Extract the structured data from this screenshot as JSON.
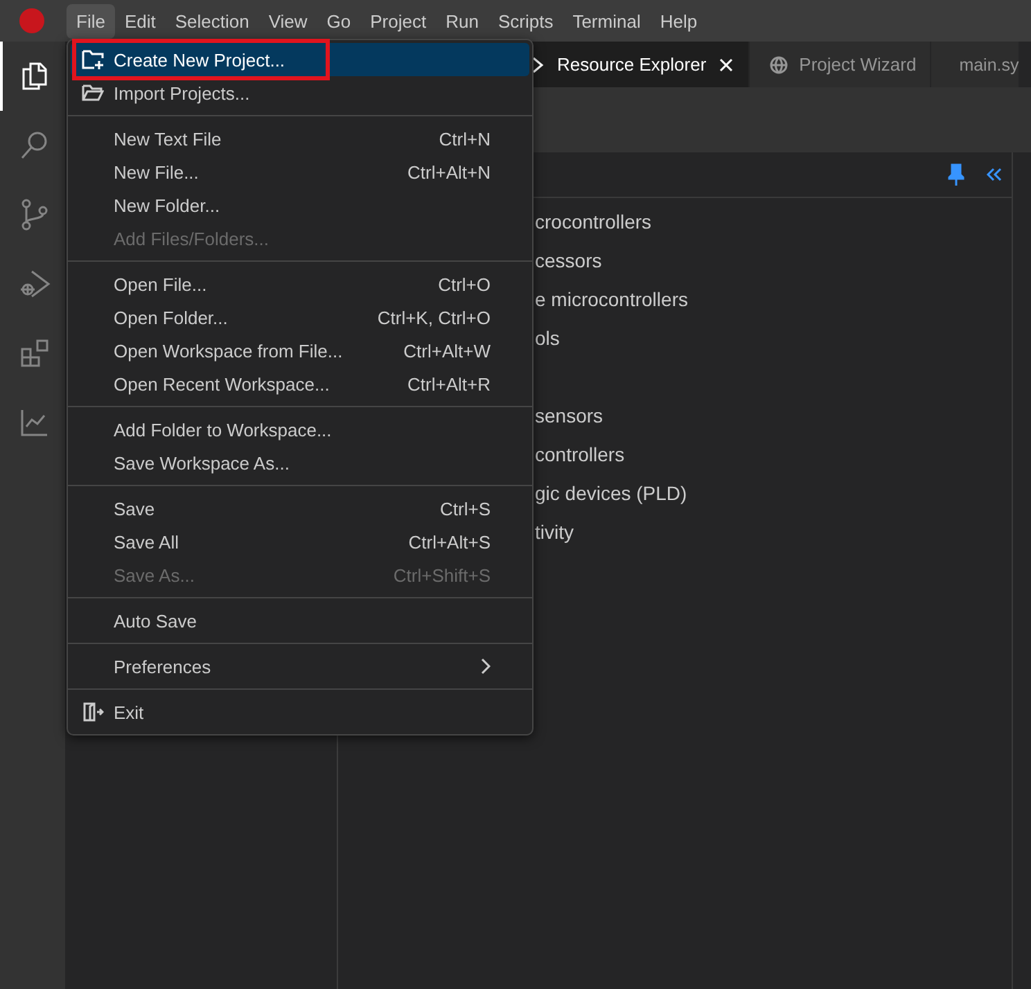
{
  "menubar": [
    {
      "label": "File",
      "selected": true
    },
    {
      "label": "Edit",
      "selected": false
    },
    {
      "label": "Selection",
      "selected": false
    },
    {
      "label": "View",
      "selected": false
    },
    {
      "label": "Go",
      "selected": false
    },
    {
      "label": "Project",
      "selected": false
    },
    {
      "label": "Run",
      "selected": false
    },
    {
      "label": "Scripts",
      "selected": false
    },
    {
      "label": "Terminal",
      "selected": false
    },
    {
      "label": "Help",
      "selected": false
    }
  ],
  "activity_bar": [
    {
      "kind": "files",
      "selected": true
    },
    {
      "kind": "search",
      "selected": false
    },
    {
      "kind": "source-control",
      "selected": false
    },
    {
      "kind": "debug",
      "selected": false
    },
    {
      "kind": "extensions",
      "selected": false
    },
    {
      "kind": "chart",
      "selected": false
    }
  ],
  "tabs": [
    {
      "label": "Resource Explorer",
      "kind": "explorer",
      "selected": true,
      "closable": true
    },
    {
      "label": "Project Wizard",
      "kind": "web",
      "selected": false,
      "closable": false
    },
    {
      "label": "main.sy",
      "kind": "file",
      "selected": false
    }
  ],
  "tree_items": [
    {
      "label": "crocontrollers"
    },
    {
      "label": "cessors"
    },
    {
      "label": "e microcontrollers"
    },
    {
      "label": "ols"
    },
    {
      "label": "sensors",
      "gap_before": true
    },
    {
      "label": "controllers"
    },
    {
      "label": "gic devices (PLD)"
    },
    {
      "label": "tivity"
    }
  ],
  "file_menu": {
    "groups": [
      [
        {
          "label": "Create New Project...",
          "kind": "new-project",
          "selected": true,
          "outlined": true,
          "disabled": false
        },
        {
          "label": "Import Projects...",
          "kind": "import",
          "selected": false,
          "outlined": false,
          "disabled": false
        }
      ],
      [
        {
          "label": "New Text File",
          "shortcut": "Ctrl+N",
          "kind": "plain",
          "selected": false,
          "outlined": false,
          "disabled": false
        },
        {
          "label": "New File...",
          "shortcut": "Ctrl+Alt+N",
          "kind": "plain",
          "selected": false,
          "outlined": false,
          "disabled": false
        },
        {
          "label": "New Folder...",
          "kind": "plain",
          "selected": false,
          "outlined": false,
          "disabled": false
        },
        {
          "label": "Add Files/Folders...",
          "kind": "plain",
          "selected": false,
          "outlined": false,
          "disabled": true
        }
      ],
      [
        {
          "label": "Open File...",
          "shortcut": "Ctrl+O",
          "kind": "plain",
          "selected": false,
          "outlined": false,
          "disabled": false
        },
        {
          "label": "Open Folder...",
          "shortcut": "Ctrl+K, Ctrl+O",
          "kind": "plain",
          "selected": false,
          "outlined": false,
          "disabled": false
        },
        {
          "label": "Open Workspace from File...",
          "shortcut": "Ctrl+Alt+W",
          "kind": "plain",
          "selected": false,
          "outlined": false,
          "disabled": false
        },
        {
          "label": "Open Recent Workspace...",
          "shortcut": "Ctrl+Alt+R",
          "kind": "plain",
          "selected": false,
          "outlined": false,
          "disabled": false
        }
      ],
      [
        {
          "label": "Add Folder to Workspace...",
          "kind": "plain",
          "selected": false,
          "outlined": false,
          "disabled": false
        },
        {
          "label": "Save Workspace As...",
          "kind": "plain",
          "selected": false,
          "outlined": false,
          "disabled": false
        }
      ],
      [
        {
          "label": "Save",
          "shortcut": "Ctrl+S",
          "kind": "plain",
          "selected": false,
          "outlined": false,
          "disabled": false
        },
        {
          "label": "Save All",
          "shortcut": "Ctrl+Alt+S",
          "kind": "plain",
          "selected": false,
          "outlined": false,
          "disabled": false
        },
        {
          "label": "Save As...",
          "shortcut": "Ctrl+Shift+S",
          "kind": "plain",
          "selected": false,
          "outlined": false,
          "disabled": true
        }
      ],
      [
        {
          "label": "Auto Save",
          "kind": "plain",
          "selected": false,
          "outlined": false,
          "disabled": false
        }
      ],
      [
        {
          "label": "Preferences",
          "kind": "submenu",
          "selected": false,
          "outlined": false,
          "disabled": false
        }
      ],
      [
        {
          "label": "Exit",
          "kind": "exit",
          "selected": false,
          "outlined": false,
          "disabled": false
        }
      ]
    ]
  }
}
